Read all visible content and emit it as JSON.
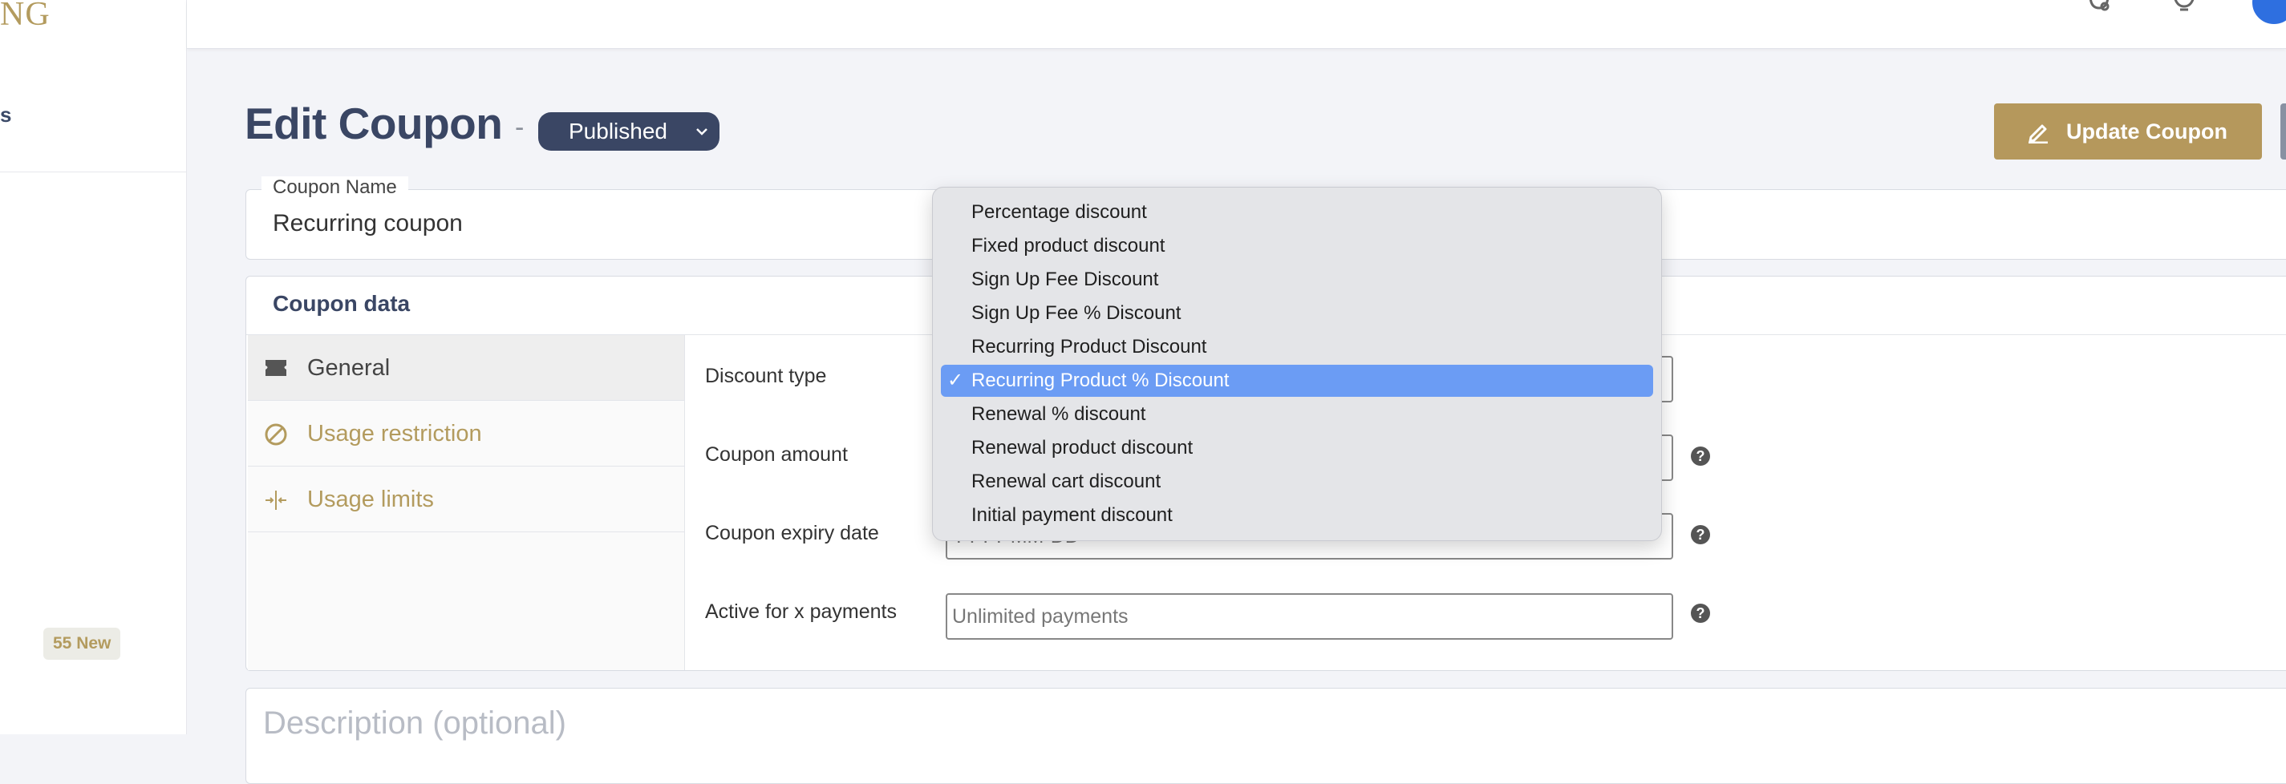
{
  "sidebar": {
    "logo_text": "NG",
    "nav_fragment": "s",
    "badge": "55 New"
  },
  "header": {
    "title": "Edit Coupon",
    "separator": "-",
    "status": "Published",
    "update_button": "Update Coupon"
  },
  "coupon_name": {
    "label": "Coupon Name",
    "value": "Recurring coupon"
  },
  "coupon_data": {
    "title": "Coupon data",
    "tabs": [
      {
        "label": "General",
        "icon": "ticket-icon"
      },
      {
        "label": "Usage restriction",
        "icon": "ban-icon"
      },
      {
        "label": "Usage limits",
        "icon": "arrows-in-icon"
      }
    ],
    "fields": {
      "discount_type": {
        "label": "Discount type"
      },
      "coupon_amount": {
        "label": "Coupon amount"
      },
      "expiry_date": {
        "label": "Coupon expiry date",
        "placeholder": "YYYY-MM-DD"
      },
      "active_payments": {
        "label": "Active for x payments",
        "placeholder": "Unlimited payments"
      }
    },
    "help_glyph": "?"
  },
  "description": {
    "placeholder": "Description (optional)"
  },
  "discount_dropdown": {
    "selected_index": 5,
    "check_glyph": "✓",
    "options": [
      "Percentage discount",
      "Fixed product discount",
      "Sign Up Fee Discount",
      "Sign Up Fee % Discount",
      "Recurring Product Discount",
      "Recurring Product % Discount",
      "Renewal % discount",
      "Renewal product discount",
      "Renewal cart discount",
      "Initial payment discount"
    ]
  },
  "colors": {
    "accent_gold": "#b5985c",
    "navy": "#3a4664",
    "selection_blue": "#6b9cf4"
  }
}
